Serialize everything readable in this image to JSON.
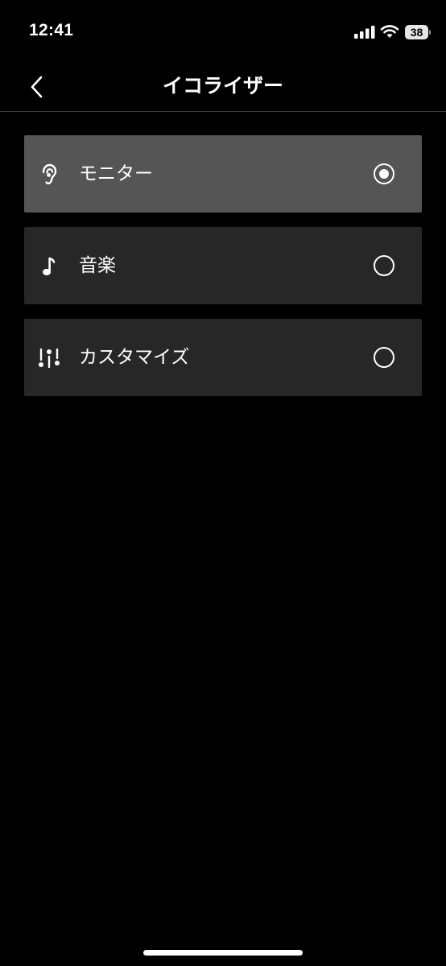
{
  "status_bar": {
    "time": "12:41",
    "battery_level": "38",
    "signal_icon": "cellular-signal-icon",
    "wifi_icon": "wifi-icon"
  },
  "nav": {
    "back_icon": "chevron-left-icon",
    "title": "イコライザー"
  },
  "equalizer_options": [
    {
      "label": "モニター",
      "icon": "ear-icon",
      "selected": true
    },
    {
      "label": "音楽",
      "icon": "music-note-icon",
      "selected": false
    },
    {
      "label": "カスタマイズ",
      "icon": "sliders-icon",
      "selected": false
    }
  ],
  "colors": {
    "background": "#000000",
    "option_background": "#272727",
    "option_selected_background": "#555555",
    "text": "#ffffff"
  }
}
